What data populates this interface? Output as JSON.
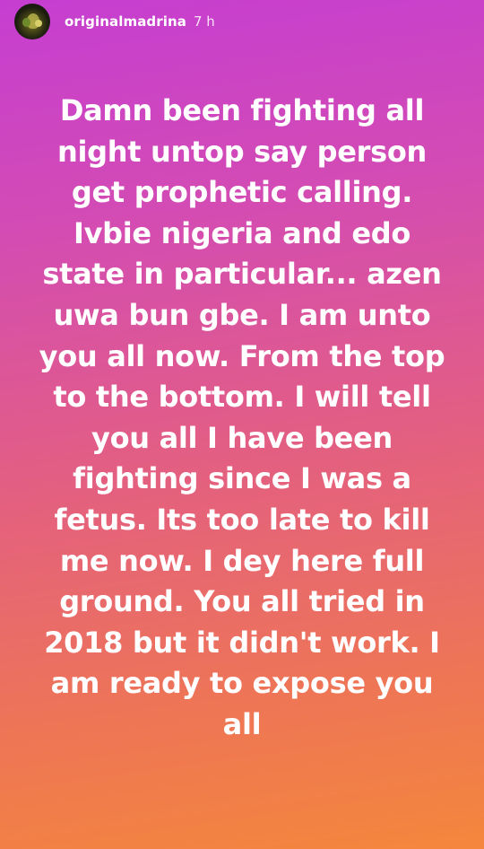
{
  "story": {
    "username": "originalmadrina",
    "time_ago": "7 h",
    "text_lines": [
      "Damn been fighting all",
      "night untop say person",
      "get prophetic calling.",
      "Ivbie nigeria and edo",
      "state in particular... azen",
      "uwa bun gbe. I am unto",
      "you all now. From the top",
      "to the bottom. I will tell",
      "you all I have been",
      "fighting since I was a",
      "fetus. Its too late to kill",
      "me now. I dey here full",
      "ground. You all tried in",
      "2018 but it didn't work. I",
      "am ready to expose you",
      "all"
    ]
  },
  "colors": {
    "gradient_top": "#c53ed1",
    "gradient_bottom": "#f4873c",
    "text": "#ffffff"
  },
  "icons": {
    "avatar": "profile-picture"
  }
}
